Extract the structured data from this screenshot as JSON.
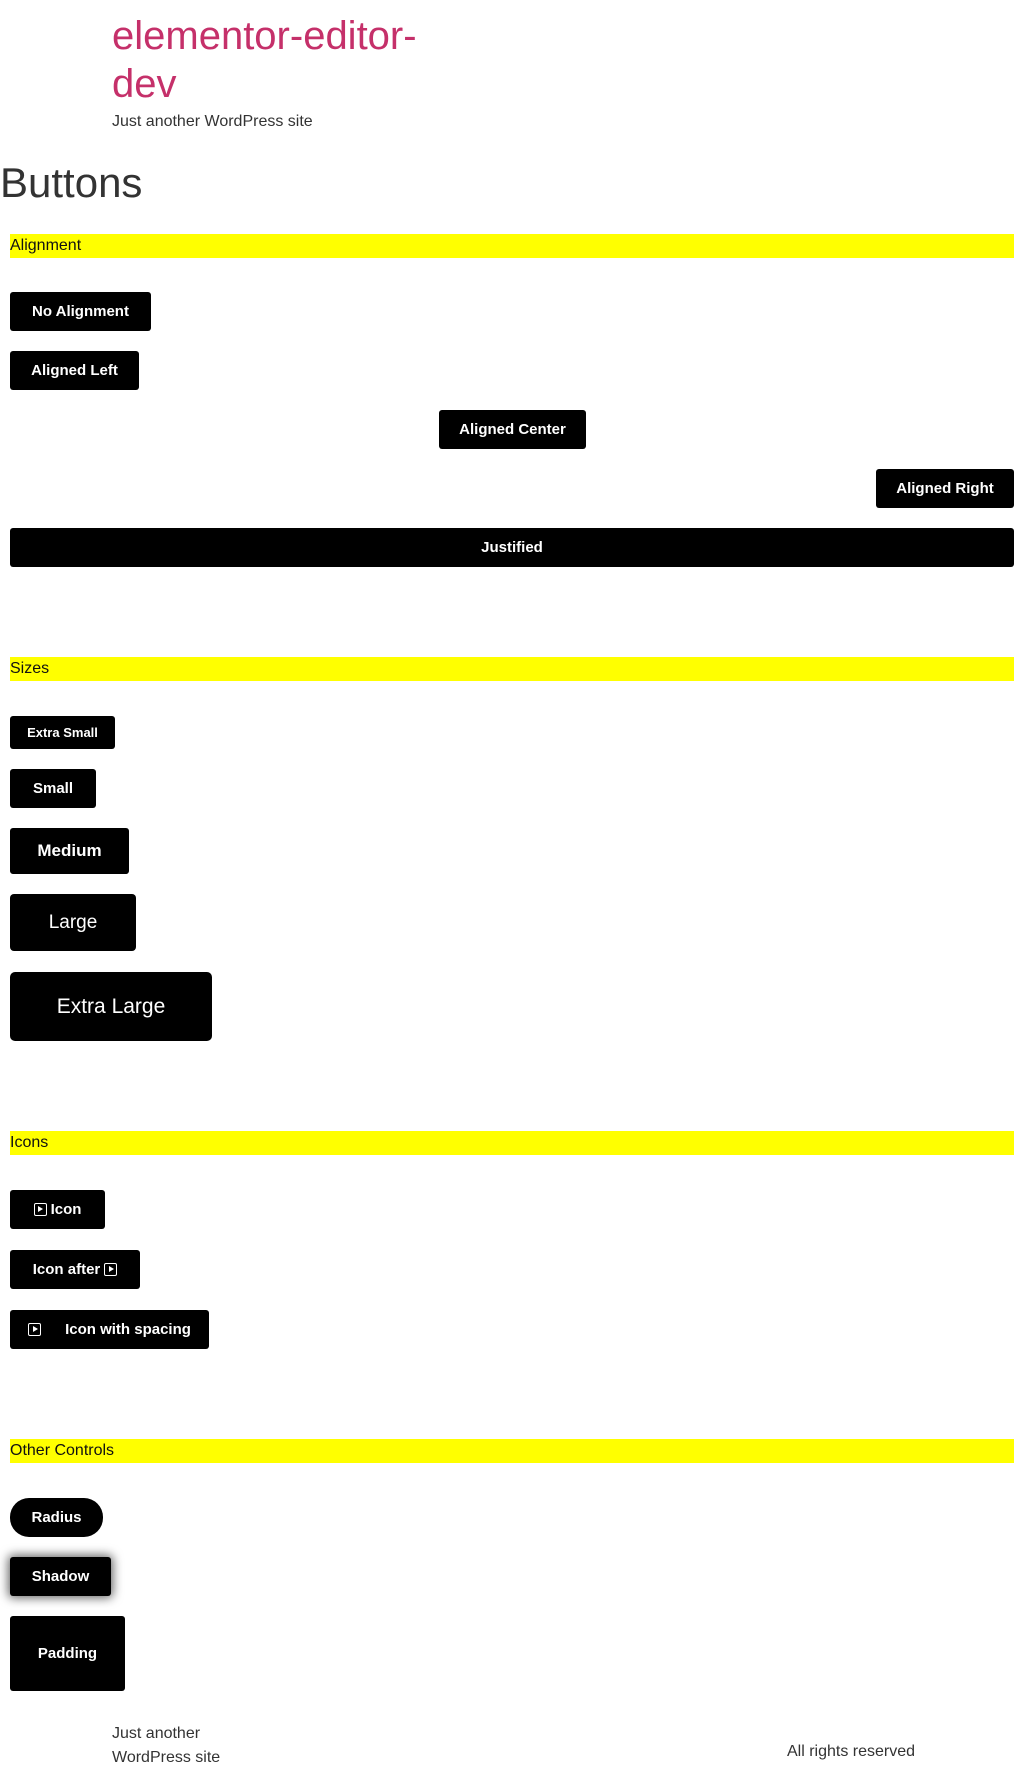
{
  "header": {
    "site_title": "elementor-editor-dev",
    "tagline": "Just another WordPress site"
  },
  "page": {
    "title": "Buttons"
  },
  "sections": {
    "alignment": {
      "heading": "Alignment",
      "buttons": {
        "no_alignment": "No Alignment",
        "aligned_left": "Aligned Left",
        "aligned_center": "Aligned Center",
        "aligned_right": "Aligned Right",
        "justified": "Justified"
      }
    },
    "sizes": {
      "heading": "Sizes",
      "buttons": {
        "extra_small": "Extra Small",
        "small": "Small",
        "medium": "Medium",
        "large": "Large",
        "extra_large": "Extra Large"
      }
    },
    "icons": {
      "heading": "Icons",
      "icon_name": "play-square-icon",
      "buttons": {
        "icon": "Icon",
        "icon_after": "Icon after",
        "icon_with_spacing": "Icon with spacing"
      }
    },
    "other_controls": {
      "heading": "Other Controls",
      "buttons": {
        "radius": "Radius",
        "shadow": "Shadow",
        "padding": "Padding"
      }
    }
  },
  "footer": {
    "tagline": "Just another WordPress site",
    "rights": "All rights reserved"
  },
  "colors": {
    "site_title": "#c5306a",
    "section_heading_bg": "#ffff00",
    "button_bg": "#000000",
    "button_text": "#ffffff",
    "body_text": "#333333"
  }
}
